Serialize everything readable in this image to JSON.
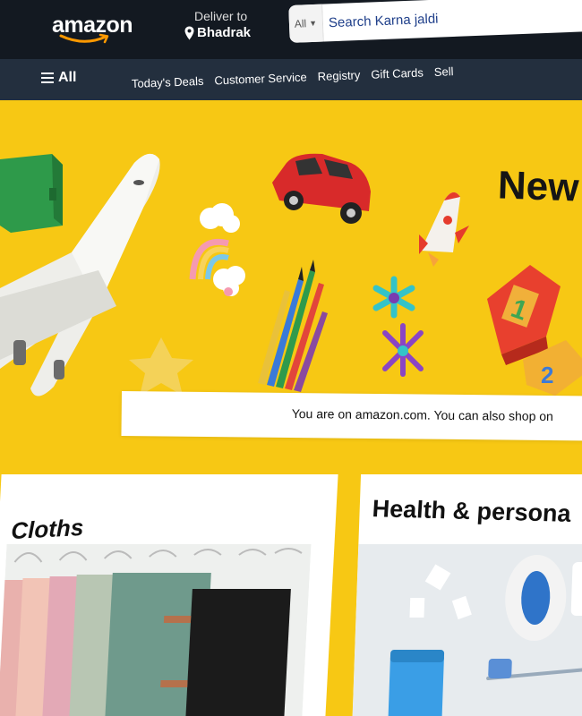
{
  "header": {
    "logo_text": "amazon",
    "deliver_label": "Deliver to",
    "deliver_location": "Bhadrak",
    "search_dept": "All",
    "search_placeholder": "Search Karna jaldi"
  },
  "nav": {
    "all_label": "All",
    "links": [
      "Today's Deals",
      "Customer Service",
      "Registry",
      "Gift Cards",
      "Sell"
    ]
  },
  "hero": {
    "title": "New",
    "notice": "You are on amazon.com. You can also shop on"
  },
  "cards": [
    {
      "title": "Cloths"
    },
    {
      "title": "Health & persona"
    }
  ],
  "colors": {
    "header_bg": "#131921",
    "nav_bg": "#232f3e",
    "hero_yellow": "#f7c814",
    "logo_orange": "#ff9900"
  }
}
